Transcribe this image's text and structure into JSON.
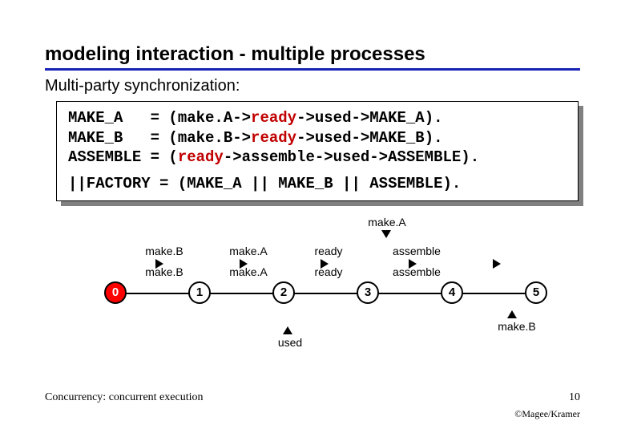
{
  "title": "modeling interaction - multiple processes",
  "subtitle": "Multi-party synchronization:",
  "code": {
    "line1_a": "MAKE_A   = (make.A->",
    "line1_r": "ready",
    "line1_b": "->used->MAKE_A).",
    "line2_a": "MAKE_B   = (make.B->",
    "line2_r": "ready",
    "line2_b": "->used->MAKE_B).",
    "line3_a": "ASSEMBLE = (",
    "line3_r": "ready",
    "line3_b": "->assemble->used->ASSEMBLE).",
    "line4": "||FACTORY = (MAKE_A || MAKE_B || ASSEMBLE)."
  },
  "diagram": {
    "states": [
      "0",
      "1",
      "2",
      "3",
      "4",
      "5"
    ],
    "top_label": "make.A",
    "transitions_top": [
      "make.B",
      "make.A",
      "ready",
      "assemble"
    ],
    "return_labels": {
      "used": "used",
      "makeB": "make.B"
    }
  },
  "footer": {
    "left": "Concurrency: concurrent execution",
    "page": "10",
    "credit": "©Magee/Kramer"
  }
}
